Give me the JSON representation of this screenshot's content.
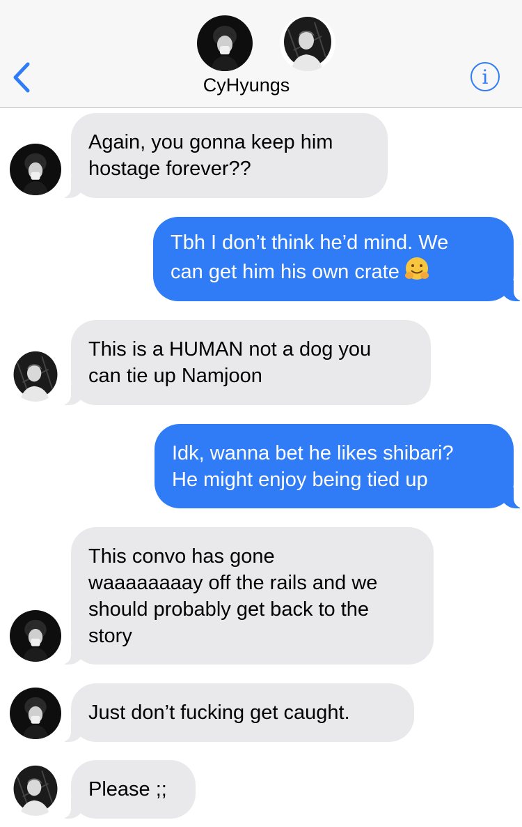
{
  "header": {
    "title": "CyHyungs",
    "info_glyph": "i",
    "back_icon": "chevron-left-icon",
    "accent_color": "#2f7cf6"
  },
  "messages": [
    {
      "sender": "member-dark",
      "direction": "incoming",
      "lines": [
        "Again, you gonna keep him",
        "hostage forever??"
      ]
    },
    {
      "sender": "me",
      "direction": "outgoing",
      "lines": [
        "Tbh I don’t think he’d mind. We",
        "can get him his own crate"
      ],
      "emoji": "hugging-face-icon"
    },
    {
      "sender": "member-light",
      "direction": "incoming",
      "lines": [
        "This is a HUMAN not a dog you",
        "can tie up Namjoon"
      ]
    },
    {
      "sender": "me",
      "direction": "outgoing",
      "lines": [
        "Idk, wanna bet he likes shibari?",
        "He might enjoy being tied up"
      ]
    },
    {
      "sender": "member-dark",
      "direction": "incoming",
      "lines": [
        "This convo has gone",
        "waaaaaaaay off the rails and we",
        "should probably get back to the",
        "story"
      ]
    },
    {
      "sender": "member-dark",
      "direction": "incoming",
      "lines": [
        "Just don’t fucking get caught."
      ]
    },
    {
      "sender": "member-light",
      "direction": "incoming",
      "lines": [
        "Please ;;"
      ]
    }
  ],
  "colors": {
    "incoming_bubble": "#e9e9eb",
    "outgoing_bubble": "#2f7cf6",
    "header_bg": "#f7f7f7"
  }
}
